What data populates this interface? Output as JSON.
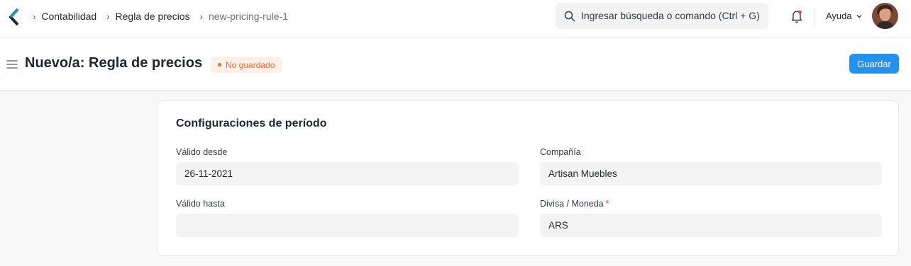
{
  "navbar": {
    "breadcrumbs": [
      "Contabilidad",
      "Regla de precios",
      "new-pricing-rule-1"
    ],
    "search": {
      "placeholder": "Ingresar búsqueda o comando (Ctrl + G)"
    },
    "help_label": "Ayuda",
    "icons": {
      "logo": "frappe-logo",
      "search": "search-icon",
      "bell": "bell-icon",
      "chevron": "chevron-down-icon",
      "avatar": "user-avatar"
    }
  },
  "page": {
    "title": "Nuevo/a: Regla de precios",
    "status": "No guardado",
    "save_label": "Guardar"
  },
  "section": {
    "title": "Configuraciones de período",
    "fields": [
      {
        "label": "Válido desde",
        "value": "26-11-2021",
        "required": false
      },
      {
        "label": "Compañía",
        "value": "Artisan Muebles",
        "required": false
      },
      {
        "label": "Válido hasta",
        "value": "",
        "required": false
      },
      {
        "label": "Divisa / Moneda",
        "value": "ARS",
        "required": true
      }
    ]
  },
  "colors": {
    "primary": "#2490ef",
    "status": "#e86c2c",
    "required": "#e24c4c"
  }
}
